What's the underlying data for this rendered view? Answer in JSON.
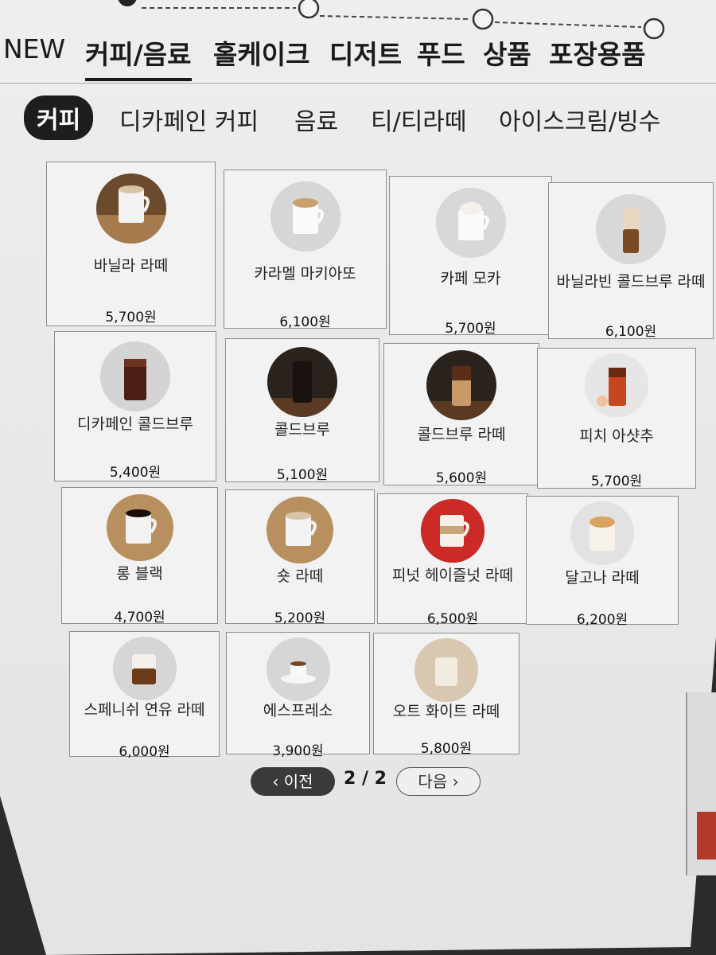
{
  "main_tabs": [
    "NEW",
    "커피/음료",
    "홀케이크",
    "디저트",
    "푸드",
    "상품",
    "포장용품"
  ],
  "sub_tabs": [
    "커피",
    "디카페인 커피",
    "음료",
    "티/티라떼",
    "아이스크림/빙수"
  ],
  "products": [
    {
      "name": "바닐라 라떼",
      "price": "5,700원",
      "icon": "hot-latte-mug"
    },
    {
      "name": "카라멜 마키아또",
      "price": "6,100원",
      "icon": "caramel-macchiato-mug"
    },
    {
      "name": "카페 모카",
      "price": "5,700원",
      "icon": "mocha-mug"
    },
    {
      "name": "바닐라빈 콜드브루 라떼",
      "price": "6,100원",
      "icon": "iced-latte-glass"
    },
    {
      "name": "디카페인 콜드브루",
      "price": "5,400원",
      "icon": "iced-coffee-glass"
    },
    {
      "name": "콜드브루",
      "price": "5,100원",
      "icon": "cold-brew-glass"
    },
    {
      "name": "콜드브루 라떼",
      "price": "5,600원",
      "icon": "cold-brew-latte-glass"
    },
    {
      "name": "피치 아샷추",
      "price": "5,700원",
      "icon": "peach-tea-glass"
    },
    {
      "name": "롱 블랙",
      "price": "4,700원",
      "icon": "black-coffee-mug"
    },
    {
      "name": "숏 라떼",
      "price": "5,200원",
      "icon": "short-latte-mug"
    },
    {
      "name": "피넛 헤이즐넛 라떼",
      "price": "6,500원",
      "icon": "hazelnut-latte-mug"
    },
    {
      "name": "달고나 라떼",
      "price": "6,200원",
      "icon": "dalgona-latte-glass"
    },
    {
      "name": "스페니쉬 연유 라떼",
      "price": "6,000원",
      "icon": "layered-latte-glass"
    },
    {
      "name": "에스프레소",
      "price": "3,900원",
      "icon": "espresso-cup"
    },
    {
      "name": "오트 화이트 라떼",
      "price": "5,800원",
      "icon": "oat-latte-glass"
    }
  ],
  "pager": {
    "prev": "‹ 이전",
    "indicator": "2 / 2",
    "next": "다음 ›"
  }
}
